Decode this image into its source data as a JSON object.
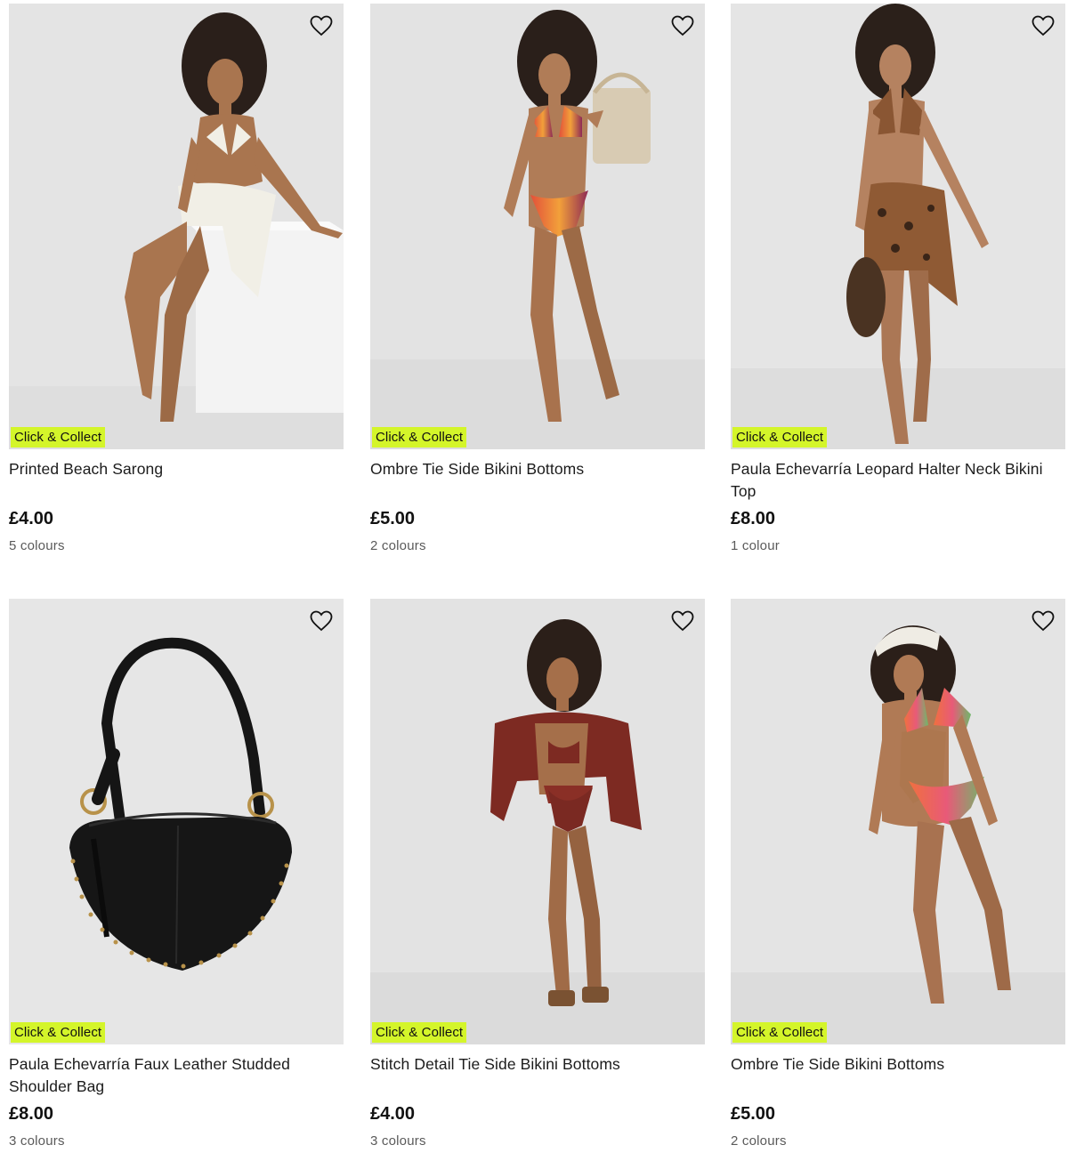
{
  "products": [
    {
      "name": "Printed Beach Sarong",
      "price": "£4.00",
      "colours": "5 colours",
      "badge": "Click & Collect",
      "favourite_icon": "heart-outline-icon",
      "image": "model-white-bikini-sarong-sitting"
    },
    {
      "name": "Ombre Tie Side Bikini Bottoms",
      "price": "£5.00",
      "colours": "2 colours",
      "badge": "Click & Collect",
      "favourite_icon": "heart-outline-icon",
      "image": "model-ombre-bikini-straw-bag"
    },
    {
      "name": "Paula Echevarría Leopard Halter Neck Bikini Top",
      "price": "£8.00",
      "colours": "1 colour",
      "badge": "Click & Collect",
      "favourite_icon": "heart-outline-icon",
      "image": "model-leopard-bikini-sarong"
    },
    {
      "name": "Paula Echevarría Faux Leather Studded Shoulder Bag",
      "price": "£8.00",
      "colours": "3 colours",
      "badge": "Click & Collect",
      "favourite_icon": "heart-outline-icon",
      "image": "black-studded-shoulder-bag"
    },
    {
      "name": "Stitch Detail Tie Side Bikini Bottoms",
      "price": "£4.00",
      "colours": "3 colours",
      "badge": "Click & Collect",
      "favourite_icon": "heart-outline-icon",
      "image": "model-rust-shirt-bikini"
    },
    {
      "name": "Ombre Tie Side Bikini Bottoms",
      "price": "£5.00",
      "colours": "2 colours",
      "badge": "Click & Collect",
      "favourite_icon": "heart-outline-icon",
      "image": "model-ombre-bikini-crochet-hat"
    }
  ],
  "colors": {
    "badge_background": "#d4f52a",
    "image_background": "#e6e6e6",
    "text": "#1c1c1c",
    "muted_text": "#5a5a5a"
  }
}
